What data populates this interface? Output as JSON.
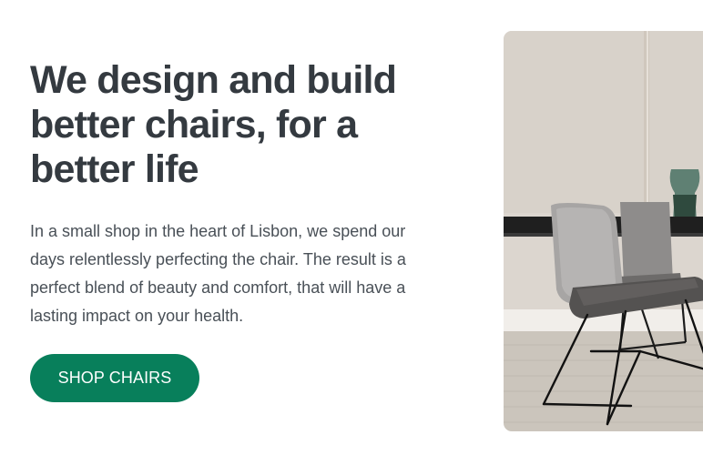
{
  "hero": {
    "title": "We design and build better chairs, for a better life",
    "description": "In a small shop in the heart of Lisbon, we spend our days relentlessly perfecting the chair. The result is a perfect blend of beauty and comfort, that will have a lasting impact on your health.",
    "cta_label": "SHOP CHAIRS"
  },
  "colors": {
    "heading": "#343a40",
    "body_text": "#495057",
    "cta_background": "#087f5b",
    "cta_text": "#ffffff"
  },
  "image": {
    "subject": "grey upholstered dining chairs with black metal legs at a black table"
  }
}
